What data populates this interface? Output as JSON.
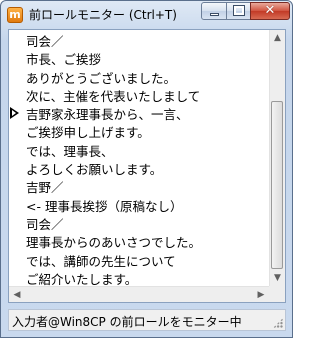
{
  "window": {
    "title": "前ロールモニター (Ctrl+T)",
    "app_icon_glyph": "m",
    "close_glyph": "✕"
  },
  "transcript": {
    "lines": [
      "司会／",
      "市長、ご挨拶",
      "ありがとうございました。",
      "次に、主催を代表いたしまして",
      "吉野家永理事長から、一言、",
      "ご挨拶申し上げます。",
      "では、理事長、",
      "よろしくお願いします。",
      "吉野／",
      "<- 理事長挨拶（原稿なし）",
      "司会／",
      "理事長からのあいさつでした。",
      "では、講師の先生について",
      "ご紹介いたします。"
    ],
    "current_line_index": 4
  },
  "scrollbars": {
    "up_arrow": "▲",
    "down_arrow": "▼",
    "left_arrow": "◀",
    "right_arrow": "▶"
  },
  "status": {
    "text": "入力者@Win8CP の前ロールをモニター中"
  }
}
